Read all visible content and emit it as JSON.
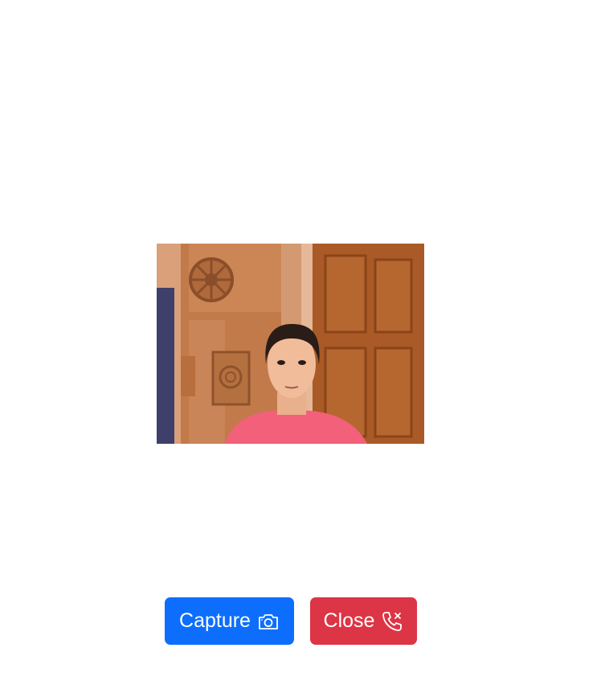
{
  "camera": {
    "feed_description_icon": "webcam-feed"
  },
  "controls": {
    "capture_label": "Capture",
    "capture_icon": "camera-icon",
    "close_label": "Close",
    "close_icon": "phone-x-icon"
  },
  "colors": {
    "capture_button": "#0d6efd",
    "close_button": "#dc3545",
    "button_text": "#ffffff",
    "background": "#ffffff"
  }
}
